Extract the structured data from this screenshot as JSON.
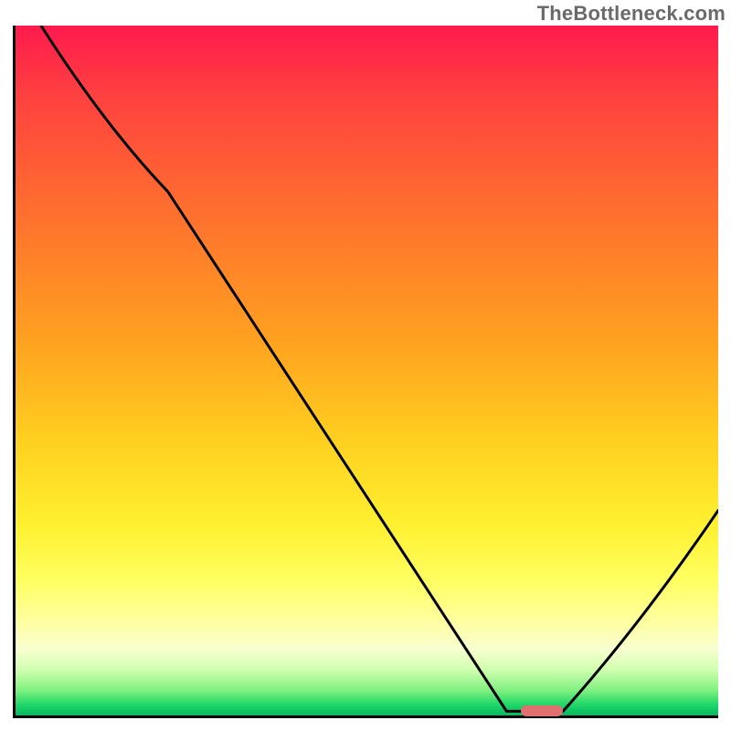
{
  "watermark": "TheBottleneck.com",
  "chart_data": {
    "type": "line",
    "title": "",
    "xlabel": "",
    "ylabel": "",
    "xlim": [
      0,
      100
    ],
    "ylim": [
      0,
      100
    ],
    "gradient_meaning": "bottleneck severity (red=high, green=none)",
    "series": [
      {
        "name": "bottleneck-curve",
        "x": [
          4,
          22,
          70,
          78,
          100
        ],
        "y": [
          100,
          76,
          1,
          1,
          30
        ]
      }
    ],
    "marker": {
      "name": "optimal-range",
      "x_start": 72,
      "x_end": 78,
      "y": 1
    }
  },
  "colors": {
    "curve": "#000000",
    "marker": "#e07070",
    "gradient_top": "#ff1a4d",
    "gradient_bottom": "#00b060"
  }
}
